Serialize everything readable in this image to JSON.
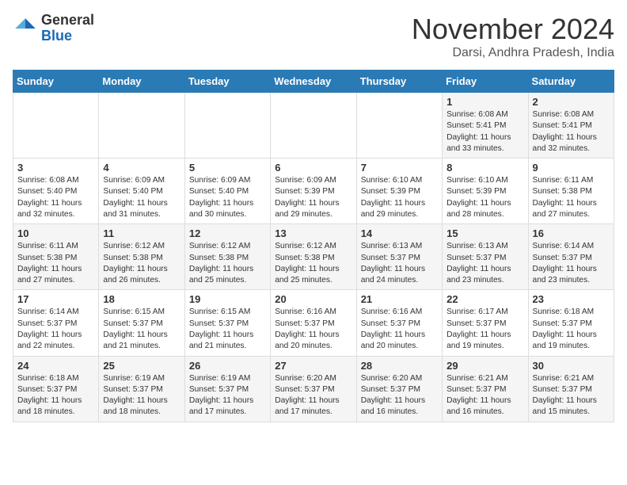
{
  "header": {
    "logo": {
      "general": "General",
      "blue": "Blue"
    },
    "title": "November 2024",
    "location": "Darsi, Andhra Pradesh, India"
  },
  "days_of_week": [
    "Sunday",
    "Monday",
    "Tuesday",
    "Wednesday",
    "Thursday",
    "Friday",
    "Saturday"
  ],
  "weeks": [
    [
      null,
      null,
      null,
      null,
      null,
      {
        "date": "1",
        "sunrise": "6:08 AM",
        "sunset": "5:41 PM",
        "daylight": "11 hours and 33 minutes."
      },
      {
        "date": "2",
        "sunrise": "6:08 AM",
        "sunset": "5:41 PM",
        "daylight": "11 hours and 32 minutes."
      }
    ],
    [
      {
        "date": "3",
        "sunrise": "6:08 AM",
        "sunset": "5:40 PM",
        "daylight": "11 hours and 32 minutes."
      },
      {
        "date": "4",
        "sunrise": "6:09 AM",
        "sunset": "5:40 PM",
        "daylight": "11 hours and 31 minutes."
      },
      {
        "date": "5",
        "sunrise": "6:09 AM",
        "sunset": "5:40 PM",
        "daylight": "11 hours and 30 minutes."
      },
      {
        "date": "6",
        "sunrise": "6:09 AM",
        "sunset": "5:39 PM",
        "daylight": "11 hours and 29 minutes."
      },
      {
        "date": "7",
        "sunrise": "6:10 AM",
        "sunset": "5:39 PM",
        "daylight": "11 hours and 29 minutes."
      },
      {
        "date": "8",
        "sunrise": "6:10 AM",
        "sunset": "5:39 PM",
        "daylight": "11 hours and 28 minutes."
      },
      {
        "date": "9",
        "sunrise": "6:11 AM",
        "sunset": "5:38 PM",
        "daylight": "11 hours and 27 minutes."
      }
    ],
    [
      {
        "date": "10",
        "sunrise": "6:11 AM",
        "sunset": "5:38 PM",
        "daylight": "11 hours and 27 minutes."
      },
      {
        "date": "11",
        "sunrise": "6:12 AM",
        "sunset": "5:38 PM",
        "daylight": "11 hours and 26 minutes."
      },
      {
        "date": "12",
        "sunrise": "6:12 AM",
        "sunset": "5:38 PM",
        "daylight": "11 hours and 25 minutes."
      },
      {
        "date": "13",
        "sunrise": "6:12 AM",
        "sunset": "5:38 PM",
        "daylight": "11 hours and 25 minutes."
      },
      {
        "date": "14",
        "sunrise": "6:13 AM",
        "sunset": "5:37 PM",
        "daylight": "11 hours and 24 minutes."
      },
      {
        "date": "15",
        "sunrise": "6:13 AM",
        "sunset": "5:37 PM",
        "daylight": "11 hours and 23 minutes."
      },
      {
        "date": "16",
        "sunrise": "6:14 AM",
        "sunset": "5:37 PM",
        "daylight": "11 hours and 23 minutes."
      }
    ],
    [
      {
        "date": "17",
        "sunrise": "6:14 AM",
        "sunset": "5:37 PM",
        "daylight": "11 hours and 22 minutes."
      },
      {
        "date": "18",
        "sunrise": "6:15 AM",
        "sunset": "5:37 PM",
        "daylight": "11 hours and 21 minutes."
      },
      {
        "date": "19",
        "sunrise": "6:15 AM",
        "sunset": "5:37 PM",
        "daylight": "11 hours and 21 minutes."
      },
      {
        "date": "20",
        "sunrise": "6:16 AM",
        "sunset": "5:37 PM",
        "daylight": "11 hours and 20 minutes."
      },
      {
        "date": "21",
        "sunrise": "6:16 AM",
        "sunset": "5:37 PM",
        "daylight": "11 hours and 20 minutes."
      },
      {
        "date": "22",
        "sunrise": "6:17 AM",
        "sunset": "5:37 PM",
        "daylight": "11 hours and 19 minutes."
      },
      {
        "date": "23",
        "sunrise": "6:18 AM",
        "sunset": "5:37 PM",
        "daylight": "11 hours and 19 minutes."
      }
    ],
    [
      {
        "date": "24",
        "sunrise": "6:18 AM",
        "sunset": "5:37 PM",
        "daylight": "11 hours and 18 minutes."
      },
      {
        "date": "25",
        "sunrise": "6:19 AM",
        "sunset": "5:37 PM",
        "daylight": "11 hours and 18 minutes."
      },
      {
        "date": "26",
        "sunrise": "6:19 AM",
        "sunset": "5:37 PM",
        "daylight": "11 hours and 17 minutes."
      },
      {
        "date": "27",
        "sunrise": "6:20 AM",
        "sunset": "5:37 PM",
        "daylight": "11 hours and 17 minutes."
      },
      {
        "date": "28",
        "sunrise": "6:20 AM",
        "sunset": "5:37 PM",
        "daylight": "11 hours and 16 minutes."
      },
      {
        "date": "29",
        "sunrise": "6:21 AM",
        "sunset": "5:37 PM",
        "daylight": "11 hours and 16 minutes."
      },
      {
        "date": "30",
        "sunrise": "6:21 AM",
        "sunset": "5:37 PM",
        "daylight": "11 hours and 15 minutes."
      }
    ]
  ],
  "labels": {
    "sunrise": "Sunrise:",
    "sunset": "Sunset:",
    "daylight": "Daylight:"
  }
}
